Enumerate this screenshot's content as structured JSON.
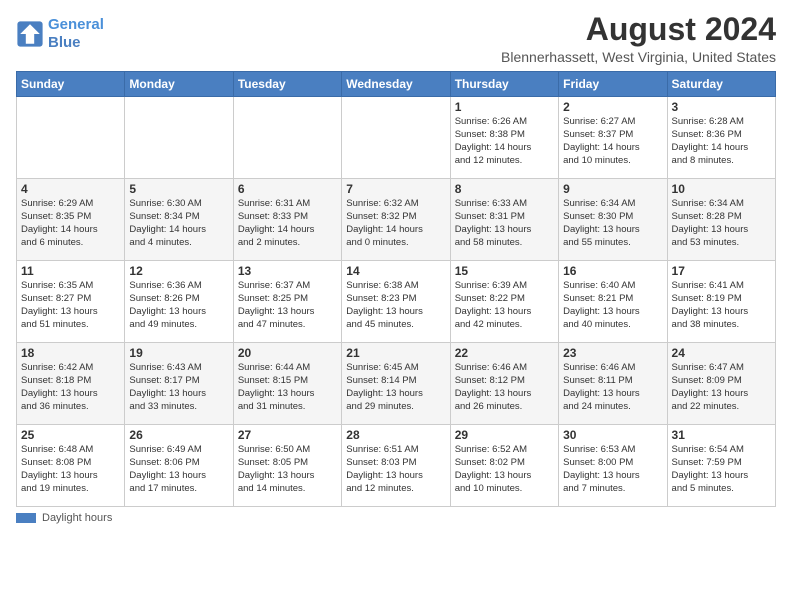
{
  "header": {
    "logo_line1": "General",
    "logo_line2": "Blue",
    "title": "August 2024",
    "subtitle": "Blennerhassett, West Virginia, United States"
  },
  "weekdays": [
    "Sunday",
    "Monday",
    "Tuesday",
    "Wednesday",
    "Thursday",
    "Friday",
    "Saturday"
  ],
  "legend": {
    "label": "Daylight hours"
  },
  "weeks": [
    [
      {
        "day": "",
        "info": ""
      },
      {
        "day": "",
        "info": ""
      },
      {
        "day": "",
        "info": ""
      },
      {
        "day": "",
        "info": ""
      },
      {
        "day": "1",
        "info": "Sunrise: 6:26 AM\nSunset: 8:38 PM\nDaylight: 14 hours\nand 12 minutes."
      },
      {
        "day": "2",
        "info": "Sunrise: 6:27 AM\nSunset: 8:37 PM\nDaylight: 14 hours\nand 10 minutes."
      },
      {
        "day": "3",
        "info": "Sunrise: 6:28 AM\nSunset: 8:36 PM\nDaylight: 14 hours\nand 8 minutes."
      }
    ],
    [
      {
        "day": "4",
        "info": "Sunrise: 6:29 AM\nSunset: 8:35 PM\nDaylight: 14 hours\nand 6 minutes."
      },
      {
        "day": "5",
        "info": "Sunrise: 6:30 AM\nSunset: 8:34 PM\nDaylight: 14 hours\nand 4 minutes."
      },
      {
        "day": "6",
        "info": "Sunrise: 6:31 AM\nSunset: 8:33 PM\nDaylight: 14 hours\nand 2 minutes."
      },
      {
        "day": "7",
        "info": "Sunrise: 6:32 AM\nSunset: 8:32 PM\nDaylight: 14 hours\nand 0 minutes."
      },
      {
        "day": "8",
        "info": "Sunrise: 6:33 AM\nSunset: 8:31 PM\nDaylight: 13 hours\nand 58 minutes."
      },
      {
        "day": "9",
        "info": "Sunrise: 6:34 AM\nSunset: 8:30 PM\nDaylight: 13 hours\nand 55 minutes."
      },
      {
        "day": "10",
        "info": "Sunrise: 6:34 AM\nSunset: 8:28 PM\nDaylight: 13 hours\nand 53 minutes."
      }
    ],
    [
      {
        "day": "11",
        "info": "Sunrise: 6:35 AM\nSunset: 8:27 PM\nDaylight: 13 hours\nand 51 minutes."
      },
      {
        "day": "12",
        "info": "Sunrise: 6:36 AM\nSunset: 8:26 PM\nDaylight: 13 hours\nand 49 minutes."
      },
      {
        "day": "13",
        "info": "Sunrise: 6:37 AM\nSunset: 8:25 PM\nDaylight: 13 hours\nand 47 minutes."
      },
      {
        "day": "14",
        "info": "Sunrise: 6:38 AM\nSunset: 8:23 PM\nDaylight: 13 hours\nand 45 minutes."
      },
      {
        "day": "15",
        "info": "Sunrise: 6:39 AM\nSunset: 8:22 PM\nDaylight: 13 hours\nand 42 minutes."
      },
      {
        "day": "16",
        "info": "Sunrise: 6:40 AM\nSunset: 8:21 PM\nDaylight: 13 hours\nand 40 minutes."
      },
      {
        "day": "17",
        "info": "Sunrise: 6:41 AM\nSunset: 8:19 PM\nDaylight: 13 hours\nand 38 minutes."
      }
    ],
    [
      {
        "day": "18",
        "info": "Sunrise: 6:42 AM\nSunset: 8:18 PM\nDaylight: 13 hours\nand 36 minutes."
      },
      {
        "day": "19",
        "info": "Sunrise: 6:43 AM\nSunset: 8:17 PM\nDaylight: 13 hours\nand 33 minutes."
      },
      {
        "day": "20",
        "info": "Sunrise: 6:44 AM\nSunset: 8:15 PM\nDaylight: 13 hours\nand 31 minutes."
      },
      {
        "day": "21",
        "info": "Sunrise: 6:45 AM\nSunset: 8:14 PM\nDaylight: 13 hours\nand 29 minutes."
      },
      {
        "day": "22",
        "info": "Sunrise: 6:46 AM\nSunset: 8:12 PM\nDaylight: 13 hours\nand 26 minutes."
      },
      {
        "day": "23",
        "info": "Sunrise: 6:46 AM\nSunset: 8:11 PM\nDaylight: 13 hours\nand 24 minutes."
      },
      {
        "day": "24",
        "info": "Sunrise: 6:47 AM\nSunset: 8:09 PM\nDaylight: 13 hours\nand 22 minutes."
      }
    ],
    [
      {
        "day": "25",
        "info": "Sunrise: 6:48 AM\nSunset: 8:08 PM\nDaylight: 13 hours\nand 19 minutes."
      },
      {
        "day": "26",
        "info": "Sunrise: 6:49 AM\nSunset: 8:06 PM\nDaylight: 13 hours\nand 17 minutes."
      },
      {
        "day": "27",
        "info": "Sunrise: 6:50 AM\nSunset: 8:05 PM\nDaylight: 13 hours\nand 14 minutes."
      },
      {
        "day": "28",
        "info": "Sunrise: 6:51 AM\nSunset: 8:03 PM\nDaylight: 13 hours\nand 12 minutes."
      },
      {
        "day": "29",
        "info": "Sunrise: 6:52 AM\nSunset: 8:02 PM\nDaylight: 13 hours\nand 10 minutes."
      },
      {
        "day": "30",
        "info": "Sunrise: 6:53 AM\nSunset: 8:00 PM\nDaylight: 13 hours\nand 7 minutes."
      },
      {
        "day": "31",
        "info": "Sunrise: 6:54 AM\nSunset: 7:59 PM\nDaylight: 13 hours\nand 5 minutes."
      }
    ]
  ]
}
